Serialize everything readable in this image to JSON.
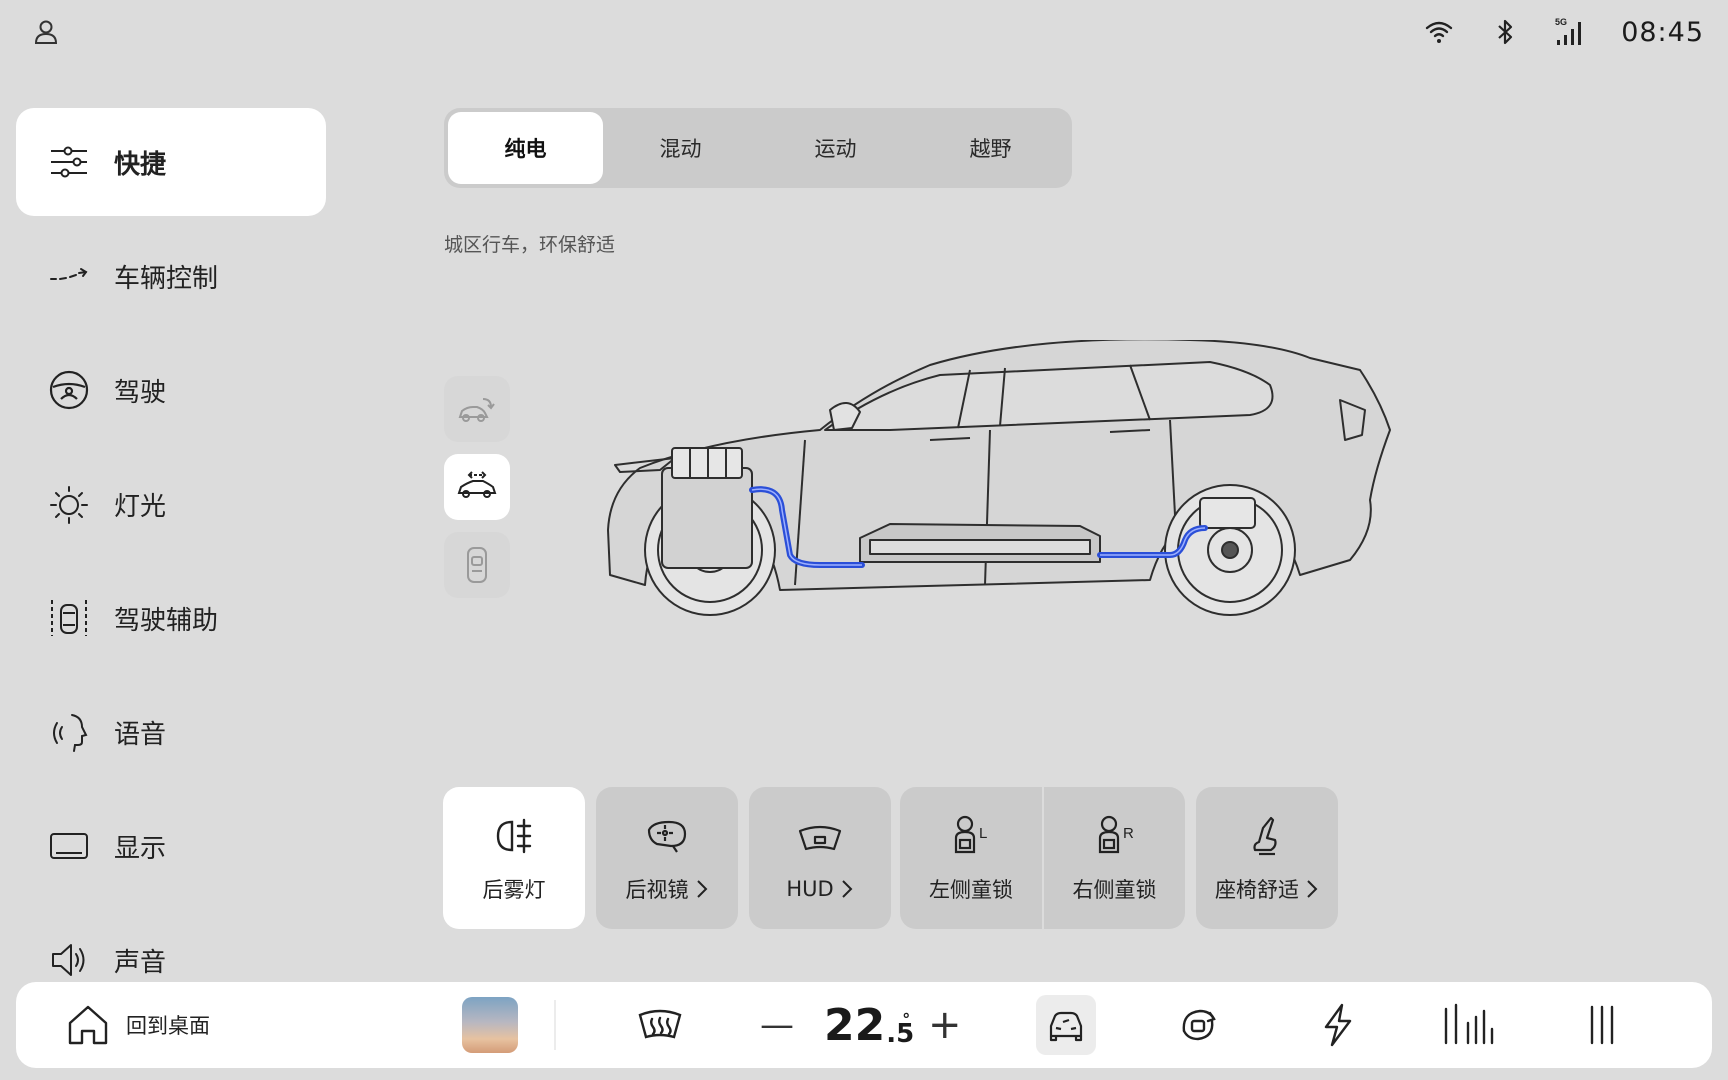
{
  "status": {
    "time": "08:45",
    "signal_label": "5G",
    "icons": [
      "user-icon",
      "wifi-icon",
      "bluetooth-icon",
      "cellular-signal-icon"
    ]
  },
  "sidebar": {
    "items": [
      {
        "label": "快捷",
        "icon": "sliders-icon",
        "active": true
      },
      {
        "label": "车辆控制",
        "icon": "vehicle-control-icon"
      },
      {
        "label": "驾驶",
        "icon": "steering-wheel-icon"
      },
      {
        "label": "灯光",
        "icon": "light-icon"
      },
      {
        "label": "驾驶辅助",
        "icon": "driving-assist-icon"
      },
      {
        "label": "语音",
        "icon": "voice-icon"
      },
      {
        "label": "显示",
        "icon": "display-icon"
      },
      {
        "label": "声音",
        "icon": "speaker-icon"
      }
    ]
  },
  "modes": {
    "tabs": [
      "纯电",
      "混动",
      "运动",
      "越野"
    ],
    "active": "纯电",
    "description": "城区行车，环保舒适"
  },
  "tiles": [
    {
      "label": "后雾灯",
      "icon": "rear-fog-light-icon",
      "active": true
    },
    {
      "label": "后视镜",
      "icon": "mirror-icon",
      "has_more": true
    },
    {
      "label": "HUD",
      "icon": "hud-icon",
      "has_more": true
    },
    {
      "label": "左侧童锁",
      "icon": "child-lock-left-icon"
    },
    {
      "label": "右侧童锁",
      "icon": "child-lock-right-icon"
    },
    {
      "label": "座椅舒适",
      "icon": "seat-icon",
      "has_more": true
    }
  ],
  "child_lock_badges": {
    "left": "L",
    "right": "R"
  },
  "dock": {
    "home_label": "回到桌面",
    "temperature": {
      "integer": "22",
      "decimal": ".5",
      "unit": "°"
    },
    "minus_label": "—",
    "plus_label": "+"
  },
  "colors": {
    "background": "#dcdcdc",
    "active": "#ffffff",
    "inactive_tile": "#cbcbcb",
    "drive_line": "#2b4fd8"
  }
}
